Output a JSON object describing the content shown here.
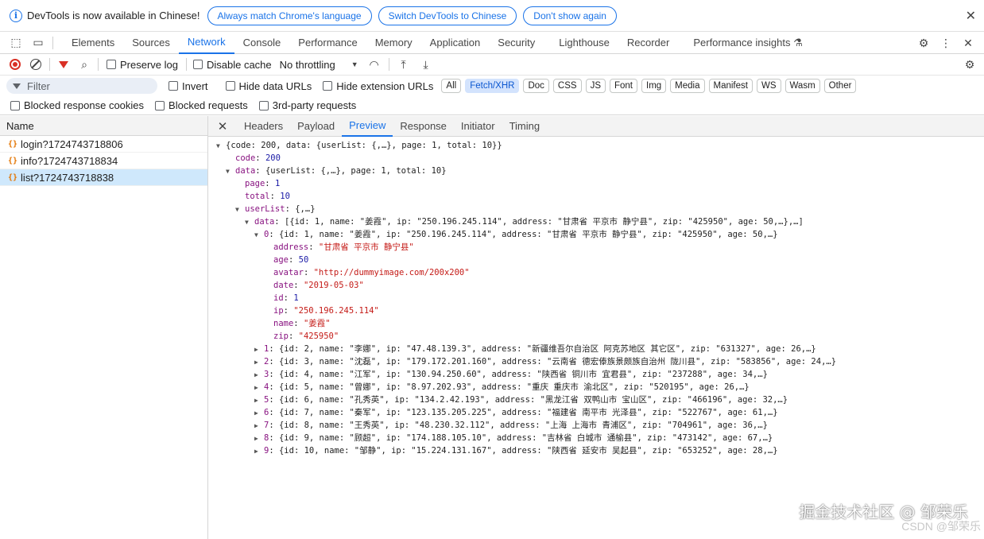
{
  "infobar": {
    "message": "DevTools is now available in Chinese!",
    "buttons": [
      "Always match Chrome's language",
      "Switch DevTools to Chinese",
      "Don't show again"
    ]
  },
  "main_tabs": [
    "Elements",
    "Sources",
    "Network",
    "Console",
    "Performance",
    "Memory",
    "Application",
    "Security",
    "Lighthouse",
    "Recorder",
    "Performance insights ⚗"
  ],
  "active_main_tab": "Network",
  "toolbar": {
    "preserve_log": "Preserve log",
    "disable_cache": "Disable cache",
    "throttling": "No throttling"
  },
  "filter": {
    "placeholder": "Filter",
    "invert": "Invert",
    "hide_data_urls": "Hide data URLs",
    "hide_extension_urls": "Hide extension URLs",
    "types": [
      "All",
      "Fetch/XHR",
      "Doc",
      "CSS",
      "JS",
      "Font",
      "Img",
      "Media",
      "Manifest",
      "WS",
      "Wasm",
      "Other"
    ],
    "active_type": "Fetch/XHR"
  },
  "blocked": {
    "blocked_cookies": "Blocked response cookies",
    "blocked_requests": "Blocked requests",
    "third_party": "3rd-party requests"
  },
  "requests": {
    "header": "Name",
    "items": [
      "login?1724743718806",
      "info?1724743718834",
      "list?1724743718838"
    ],
    "selected": 2
  },
  "detail_tabs": [
    "Headers",
    "Payload",
    "Preview",
    "Response",
    "Initiator",
    "Timing"
  ],
  "active_detail_tab": "Preview",
  "preview": {
    "root": "{code: 200, data: {userList: {,…}, page: 1, total: 10}}",
    "code": "200",
    "data_summary": "{userList: {,…}, page: 1, total: 10}",
    "page": "1",
    "total": "10",
    "userList_summary": "{,…}",
    "data_list_summary": "[{id: 1, name: \"姜霞\", ip: \"250.196.245.114\", address: \"甘肃省 平京市 静宁县\", zip: \"425950\", age: 50,…},…]",
    "item0_summary": "{id: 1, name: \"姜霞\", ip: \"250.196.245.114\", address: \"甘肃省 平京市 静宁县\", zip: \"425950\", age: 50,…}",
    "item0": {
      "address": "\"甘肃省 平京市 静宁县\"",
      "age": "50",
      "avatar": "\"http://dummyimage.com/200x200\"",
      "date": "\"2019-05-03\"",
      "id": "1",
      "ip": "\"250.196.245.114\"",
      "name": "\"姜霞\"",
      "zip": "\"425950\""
    },
    "collapsed": [
      "{id: 2, name: \"李娜\", ip: \"47.48.139.3\", address: \"新疆维吾尔自治区 阿克苏地区 其它区\", zip: \"631327\", age: 26,…}",
      "{id: 3, name: \"沈磊\", ip: \"179.172.201.160\", address: \"云南省 德宏傣族景颇族自治州 陇川县\", zip: \"583856\", age: 24,…}",
      "{id: 4, name: \"江军\", ip: \"130.94.250.60\", address: \"陕西省 铜川市 宜君县\", zip: \"237288\", age: 34,…}",
      "{id: 5, name: \"曾娜\", ip: \"8.97.202.93\", address: \"重庆 重庆市 渝北区\", zip: \"520195\", age: 26,…}",
      "{id: 6, name: \"孔秀英\", ip: \"134.2.42.193\", address: \"黑龙江省 双鸭山市 宝山区\", zip: \"466196\", age: 32,…}",
      "{id: 7, name: \"秦军\", ip: \"123.135.205.225\", address: \"福建省 南平市 光泽县\", zip: \"522767\", age: 61,…}",
      "{id: 8, name: \"王秀英\", ip: \"48.230.32.112\", address: \"上海 上海市 青浦区\", zip: \"704961\", age: 36,…}",
      "{id: 9, name: \"顾超\", ip: \"174.188.105.10\", address: \"吉林省 白城市 通榆县\", zip: \"473142\", age: 67,…}",
      "{id: 10, name: \"邹静\", ip: \"15.224.131.167\", address: \"陕西省 延安市 吴起县\", zip: \"653252\", age: 28,…}"
    ]
  },
  "watermark": "掘金技术社区 @ 邹荣乐",
  "watermark2": "CSDN @邹荣乐"
}
